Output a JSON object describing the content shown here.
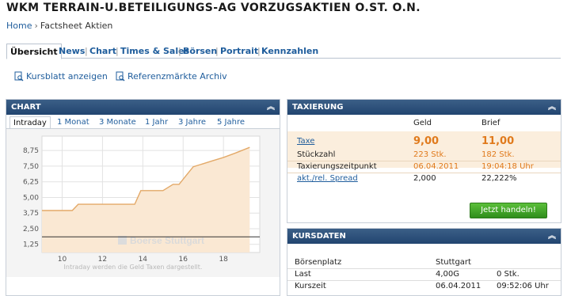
{
  "page": {
    "title": "WKM TERRAIN-U.BETEILIGUNGS-AG VORZUGSAKTIEN O.ST. O.N.",
    "breadcrumb": {
      "home": "Home",
      "separator": "›",
      "current": "Factsheet Aktien"
    }
  },
  "nav": {
    "tabs": [
      {
        "label": "Übersicht",
        "active": true
      },
      {
        "label": "News"
      },
      {
        "label": "Chart"
      },
      {
        "label": "Times & Sales"
      },
      {
        "label": "Börsen"
      },
      {
        "label": "Portrait"
      },
      {
        "label": "Kennzahlen"
      }
    ],
    "separator": "|"
  },
  "links": {
    "kursblatt": "Kursblatt anzeigen",
    "referenz": "Referenzmärkte Archiv"
  },
  "chart_panel": {
    "header": "CHART",
    "tabs": [
      {
        "label": "Intraday",
        "active": true
      },
      {
        "label": "1 Monat"
      },
      {
        "label": "3 Monate"
      },
      {
        "label": "1 Jahr"
      },
      {
        "label": "3 Jahre"
      },
      {
        "label": "5 Jahre"
      }
    ],
    "watermark": "Boerse Stuttgart",
    "caption": "Intraday werden die Geld Taxen dargestellt."
  },
  "chart_data": {
    "type": "area",
    "x": [
      9.0,
      9.5,
      10.0,
      10.5,
      10.8,
      11.3,
      12.0,
      13.0,
      13.6,
      13.9,
      14.2,
      15.0,
      15.5,
      15.8,
      16.2,
      16.5,
      17.0,
      17.5,
      18.0,
      18.6,
      19.3
    ],
    "y": [
      3.95,
      3.95,
      3.95,
      3.95,
      4.45,
      4.45,
      4.45,
      4.45,
      4.45,
      5.55,
      5.55,
      5.55,
      6.05,
      6.05,
      6.85,
      7.45,
      7.7,
      7.95,
      8.2,
      8.55,
      9.0
    ],
    "reference_line": 1.85,
    "yticks": [
      "8,75",
      "7,50",
      "6,25",
      "5,00",
      "3,75",
      "2,50",
      "1,25"
    ],
    "ytick_values": [
      8.75,
      7.5,
      6.25,
      5.0,
      3.75,
      2.5,
      1.25
    ],
    "xticks": [
      "10",
      "12",
      "14",
      "16",
      "18"
    ],
    "xtick_values": [
      10,
      12,
      14,
      16,
      18
    ],
    "xlim": [
      9.0,
      19.8
    ],
    "ylim": [
      0.6,
      9.9
    ],
    "colors": {
      "line": "#e3a968",
      "fill": "#fae8d3",
      "reference": "#333333",
      "grid": "#e2e2e2"
    }
  },
  "taxierung": {
    "header": "TAXIERUNG",
    "col_geld": "Geld",
    "col_brief": "Brief",
    "taxe": {
      "label": "Taxe",
      "geld": "9,00",
      "brief": "11,00"
    },
    "stueckzahl": {
      "label": "Stückzahl",
      "geld": "223 Stk.",
      "brief": "182 Stk."
    },
    "zeitpunkt": {
      "label": "Taxierungszeitpunkt",
      "geld": "06.04.2011",
      "brief": "19:04:18 Uhr"
    },
    "spread": {
      "label": "akt./rel. Spread",
      "geld": "2,000",
      "brief": "22,222%"
    },
    "button": "Jetzt handeln!"
  },
  "kursdaten": {
    "header": "KURSDATEN",
    "boersenplatz": {
      "label": "Börsenplatz",
      "value": "Stuttgart"
    },
    "last": {
      "label": "Last",
      "value": "4,00G",
      "extra": "0 Stk."
    },
    "kurszeit": {
      "label": "Kurszeit",
      "value": "06.04.2011",
      "extra": "09:52:06 Uhr"
    }
  },
  "icons": {
    "collapse": "chevron-up-icon",
    "document": "document-search-icon"
  }
}
